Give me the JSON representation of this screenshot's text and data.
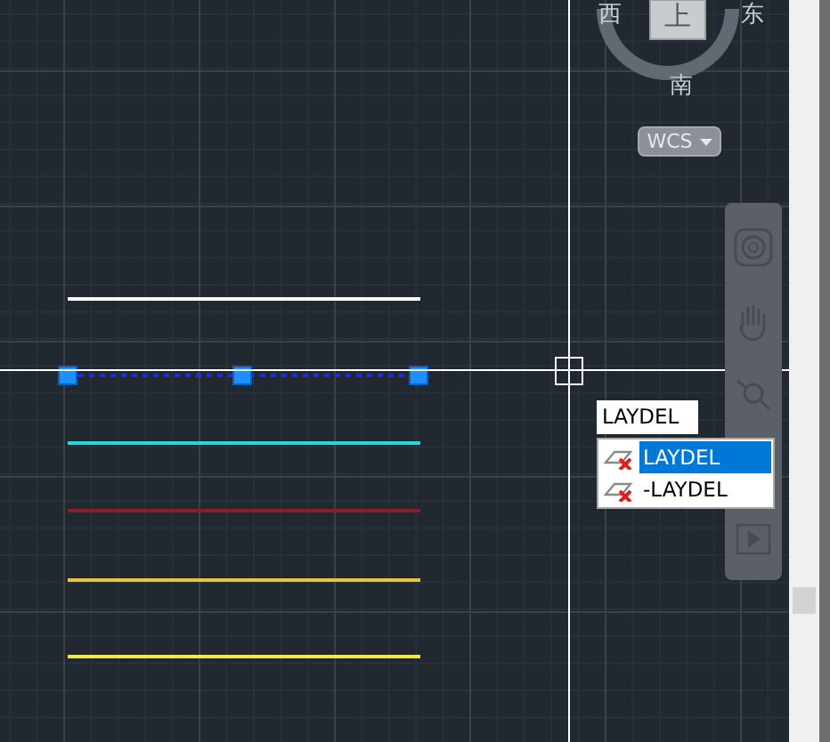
{
  "viewcube": {
    "top": "上",
    "west": "西",
    "east": "东",
    "south": "南",
    "ucs_button": "WCS"
  },
  "lines": [
    {
      "color": "#ffffff",
      "selected": false
    },
    {
      "color": "#1b2ee0",
      "selected": true
    },
    {
      "color": "#22d8d8",
      "selected": false
    },
    {
      "color": "#8a1f26",
      "selected": false
    },
    {
      "color": "#e8c441",
      "selected": false
    },
    {
      "color": "#f2e84a",
      "selected": false
    }
  ],
  "command_input": {
    "value": "LAYDEL"
  },
  "suggestions": [
    {
      "label": "LAYDEL",
      "selected": true
    },
    {
      "label": "-LAYDEL",
      "selected": false
    }
  ]
}
